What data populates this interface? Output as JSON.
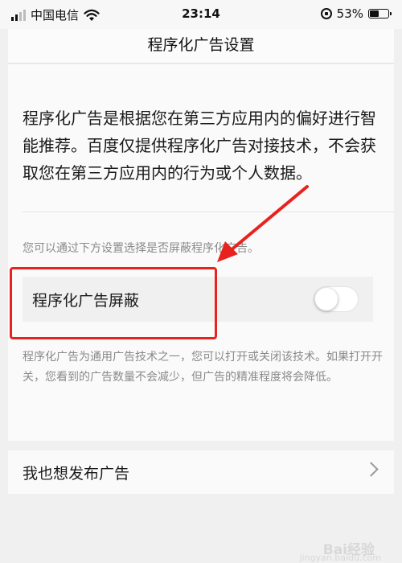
{
  "status_bar": {
    "carrier": "中国电信",
    "time": "23:14",
    "battery_percent": "53%",
    "battery_level": 0.53
  },
  "header": {
    "title": "程序化广告设置"
  },
  "main": {
    "intro_text": "程序化广告是根据您在第三方应用内的偏好进行智能推荐。百度仅提供程序化广告对接技术，不会获取您在第三方应用内的行为或个人数据。",
    "hint_text": "您可以通过下方设置选择是否屏蔽程序化广告。",
    "toggle": {
      "label": "程序化广告屏蔽",
      "on": false
    },
    "description": "程序化广告为通用广告技术之一，您可以打开或关闭该技术。如果打开开关，您看到的广告数量不会减少，但广告的精准程度将会降低。"
  },
  "publish_row": {
    "label": "我也想发布广告"
  },
  "watermark": {
    "text": "Bai经验",
    "sub": "jingyan.baidu.com"
  },
  "colors": {
    "annotation_red": "#e8231f",
    "background": "#f0f0f0",
    "card": "#fafafa"
  }
}
